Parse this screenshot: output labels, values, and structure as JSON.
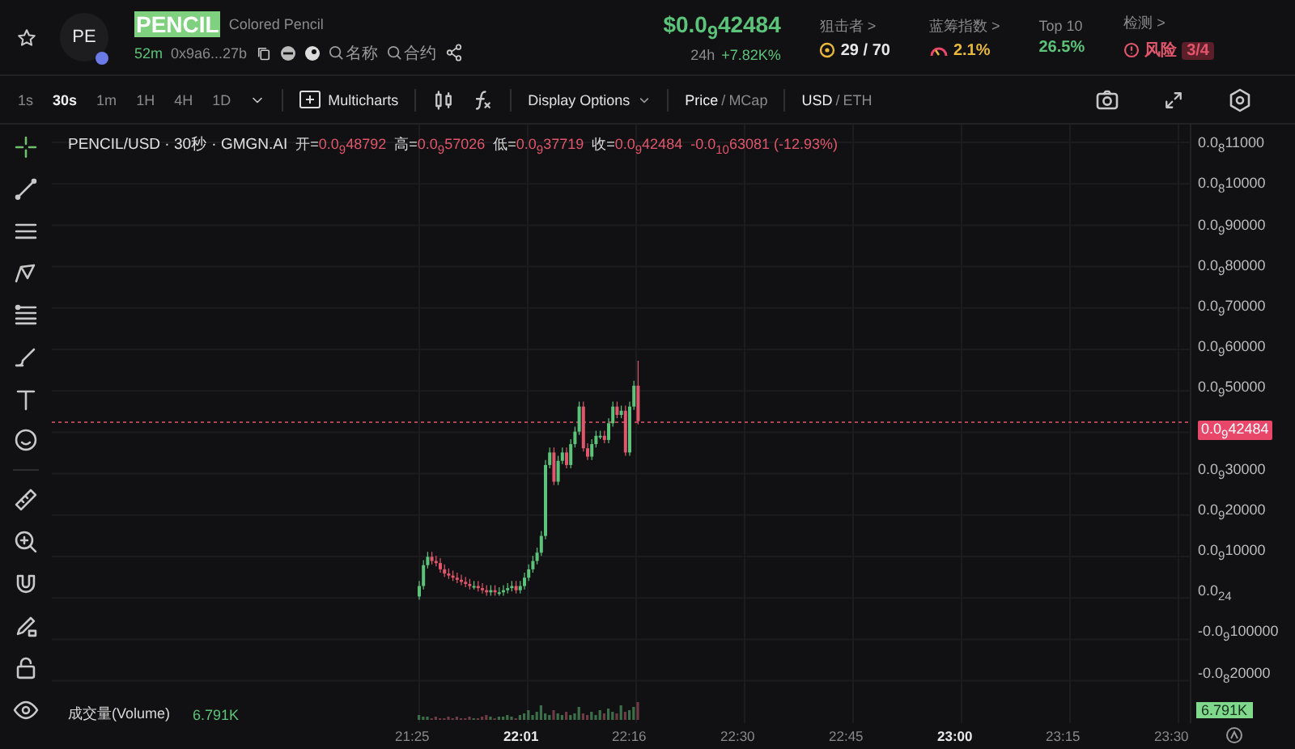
{
  "token": {
    "avatar": "PE",
    "symbol": "PENCIL",
    "name": "Colored Pencil",
    "age": "52m",
    "address": "0x9a6...27b",
    "links": [
      "名称",
      "合约"
    ]
  },
  "price": {
    "value": "$0.0$_{9}$42484",
    "change_label": "24h",
    "change": "+7.82K%"
  },
  "stats": [
    {
      "label": "狙击者 >",
      "value": "29 / 70",
      "kind": "snipers"
    },
    {
      "label": "蓝筹指数 >",
      "value": "2.1%",
      "kind": "bluechip"
    },
    {
      "label": "Top 10",
      "value": "26.5%",
      "kind": "plain"
    },
    {
      "label": "检测 >",
      "value": "风险",
      "badge": "3/4",
      "kind": "risk"
    }
  ],
  "toolbar": {
    "intervals": [
      {
        "label": "1s",
        "selected": false
      },
      {
        "label": "30s",
        "selected": true
      },
      {
        "label": "1m",
        "selected": false
      },
      {
        "label": "1H",
        "selected": false
      },
      {
        "label": "4H",
        "selected": false
      },
      {
        "label": "1D",
        "selected": false
      }
    ],
    "multicharts": "Multicharts",
    "display_options": "Display Options",
    "unit_toggle": {
      "separator": "/",
      "options": [
        {
          "label": "Price",
          "selected": true
        },
        {
          "label": "MCap",
          "selected": false
        }
      ]
    },
    "currency_toggle": {
      "separator": "/",
      "options": [
        {
          "label": "USD",
          "selected": true
        },
        {
          "label": "ETH",
          "selected": false
        }
      ]
    }
  },
  "legend": {
    "title": "PENCIL/USD · 30秒 · GMGN.AI",
    "ohlc": [
      {
        "label": "开=",
        "value": "0.0$_{9}$48792"
      },
      {
        "label": "高=",
        "value": "0.0$_{9}$57026"
      },
      {
        "label": "低=",
        "value": "0.0$_{9}$37719"
      },
      {
        "label": "收=",
        "value": "0.0$_{9}$42484"
      }
    ],
    "change": "-0.0$_{10}$63081 (-12.93%)"
  },
  "price_axis": [
    {
      "text": "0.0$_{8}$11000",
      "kind": "tick"
    },
    {
      "text": "0.0$_{8}$10000",
      "kind": "tick"
    },
    {
      "text": "0.0$_{9}$90000",
      "kind": "tick"
    },
    {
      "text": "0.0$_{9}$80000",
      "kind": "tick"
    },
    {
      "text": "0.0$_{9}$70000",
      "kind": "tick"
    },
    {
      "text": "0.0$_{9}$60000",
      "kind": "tick"
    },
    {
      "text": "0.0$_{9}$50000",
      "kind": "tick"
    },
    {
      "text": "0.0$_{9}$42484",
      "kind": "current"
    },
    {
      "text": "0.0$_{9}$30000",
      "kind": "tick"
    },
    {
      "text": "0.0$_{9}$20000",
      "kind": "tick"
    },
    {
      "text": "0.0$_{9}$10000",
      "kind": "tick"
    },
    {
      "text": "0.0$_{24}$",
      "kind": "tick"
    },
    {
      "text": "-0.0$_{9}$100000",
      "kind": "tick"
    },
    {
      "text": "-0.0$_{8}$20000",
      "kind": "tick"
    }
  ],
  "volume": {
    "label": "成交量(Volume)",
    "value": "6.791K",
    "axis_badge": "6.791K"
  },
  "time_axis": [
    {
      "text": "21:25",
      "bold": false
    },
    {
      "text": "22:01",
      "bold": true
    },
    {
      "text": "22:16",
      "bold": false
    },
    {
      "text": "22:30",
      "bold": false
    },
    {
      "text": "22:45",
      "bold": false
    },
    {
      "text": "23:00",
      "bold": true
    },
    {
      "text": "23:15",
      "bold": false
    },
    {
      "text": "23:30",
      "bold": false
    }
  ]
}
